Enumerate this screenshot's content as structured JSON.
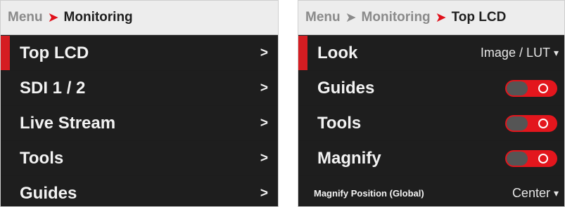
{
  "left_panel": {
    "breadcrumb": {
      "root": "Menu",
      "current": "Monitoring"
    },
    "items": [
      {
        "label": "Top LCD",
        "selected": true
      },
      {
        "label": "SDI 1 / 2",
        "selected": false
      },
      {
        "label": "Live Stream",
        "selected": false
      },
      {
        "label": "Tools",
        "selected": false
      },
      {
        "label": "Guides",
        "selected": false
      }
    ],
    "chevron": ">"
  },
  "right_panel": {
    "breadcrumb": {
      "root": "Menu",
      "parent": "Monitoring",
      "current": "Top LCD"
    },
    "look": {
      "label": "Look",
      "value": "Image / LUT"
    },
    "guides": {
      "label": "Guides",
      "state": "on"
    },
    "tools": {
      "label": "Tools",
      "state": "on"
    },
    "magnify": {
      "label": "Magnify",
      "state": "on"
    },
    "magnify_position": {
      "label": "Magnify Position (Global)",
      "value": "Center"
    },
    "dropdown_caret": "▾"
  },
  "colors": {
    "accent_red": "#e0101a",
    "panel_bg": "#1c1c1c",
    "header_bg": "#ededed",
    "toggle_knob": "#555555"
  }
}
